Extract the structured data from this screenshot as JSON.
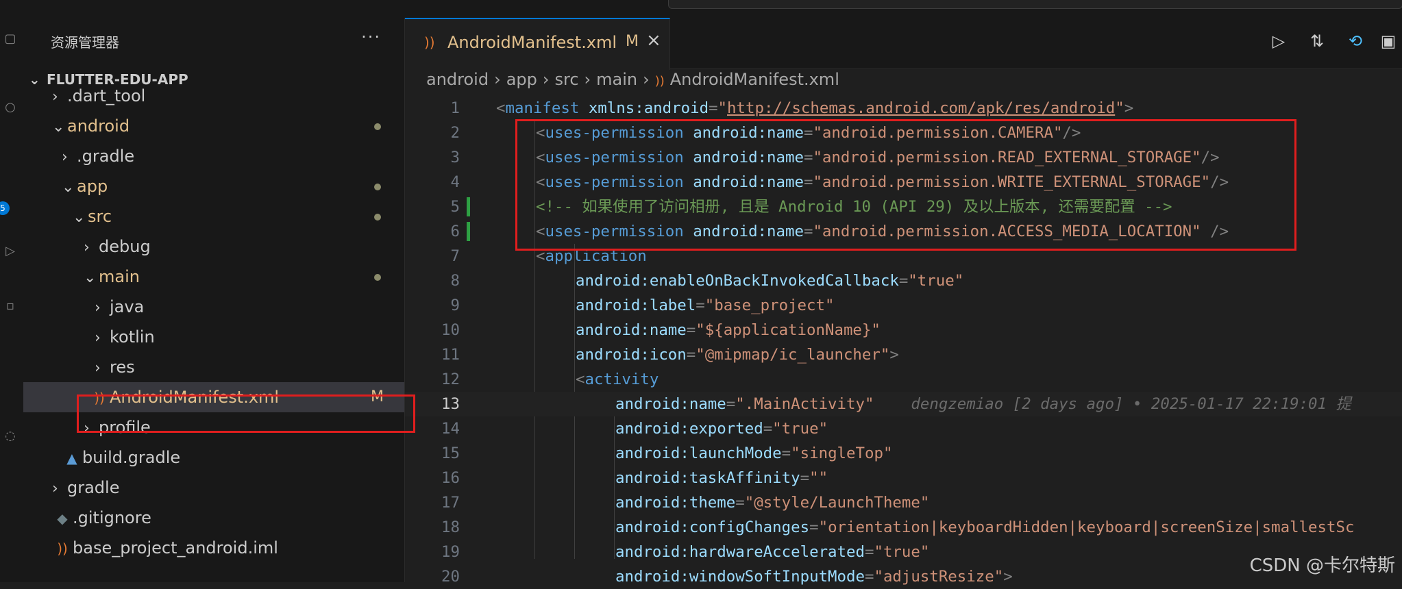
{
  "explorer": {
    "title": "资源管理器",
    "more": "···",
    "project": "FLUTTER-EDU-APP",
    "tree": [
      {
        "label": ".dart_tool",
        "chev": "›",
        "icon": "",
        "mod": ""
      },
      {
        "label": "android",
        "chev": "⌄",
        "icon": "",
        "mod": "dot"
      },
      {
        "label": ".gradle",
        "chev": "›",
        "icon": "",
        "mod": ""
      },
      {
        "label": "app",
        "chev": "⌄",
        "icon": "",
        "mod": "dot"
      },
      {
        "label": "src",
        "chev": "⌄",
        "icon": "",
        "mod": "dot"
      },
      {
        "label": "debug",
        "chev": "›",
        "icon": "",
        "mod": ""
      },
      {
        "label": "main",
        "chev": "⌄",
        "icon": "",
        "mod": "dot"
      },
      {
        "label": "java",
        "chev": "›",
        "icon": "",
        "mod": ""
      },
      {
        "label": "kotlin",
        "chev": "›",
        "icon": "",
        "mod": ""
      },
      {
        "label": "res",
        "chev": "›",
        "icon": "",
        "mod": ""
      },
      {
        "label": "AndroidManifest.xml",
        "chev": "",
        "icon": "rss-icon",
        "mod": "M"
      },
      {
        "label": "profile",
        "chev": "›",
        "icon": "",
        "mod": ""
      },
      {
        "label": "build.gradle",
        "chev": "",
        "icon": "elephant-icon",
        "mod": ""
      },
      {
        "label": "gradle",
        "chev": "›",
        "icon": "",
        "mod": ""
      },
      {
        "label": ".gitignore",
        "chev": "",
        "icon": "git-icon",
        "mod": ""
      },
      {
        "label": "base_project_android.iml",
        "chev": "",
        "icon": "rss-icon",
        "mod": ""
      }
    ]
  },
  "tab": {
    "name": "AndroidManifest.xml",
    "status": "M",
    "close": "×"
  },
  "breadcrumbs": [
    "android",
    "app",
    "src",
    "main",
    "AndroidManifest.xml"
  ],
  "badge": "5",
  "code": {
    "line_numbers": [
      "1",
      "2",
      "3",
      "4",
      "5",
      "6",
      "7",
      "8",
      "9",
      "10",
      "11",
      "12",
      "13",
      "14",
      "15",
      "16",
      "17",
      "18",
      "19",
      "20"
    ],
    "current_line": "13",
    "manifest_ns": "http://schemas.android.com/apk/res/android",
    "perm_camera": "android.permission.CAMERA",
    "perm_read": "android.permission.READ_EXTERNAL_STORAGE",
    "perm_write": "android.permission.WRITE_EXTERNAL_STORAGE",
    "comment": "<!-- 如果使用了访问相册, 且是 Android 10 (API 29) 及以上版本, 还需要配置 -->",
    "perm_media": "android.permission.ACCESS_MEDIA_LOCATION",
    "enable_back": "true",
    "label": "base_project",
    "app_name": "${applicationName}",
    "icon": "@mipmap/ic_launcher",
    "activity_name": ".MainActivity",
    "blame": "dengzemiao [2 days ago] • 2025-01-17 22:19:01 提",
    "exported": "true",
    "launch_mode": "singleTop",
    "task_affinity": "",
    "theme": "@style/LaunchTheme",
    "config_changes": "orientation|keyboardHidden|keyboard|screenSize|smallestSc",
    "hw_accel": "true",
    "soft_input": "adjustResize"
  },
  "watermark": "CSDN @卡尔特斯",
  "colors": {
    "accent": "#0078d4",
    "highlight_box": "#e01e1e",
    "modified": "#e2c08d"
  }
}
